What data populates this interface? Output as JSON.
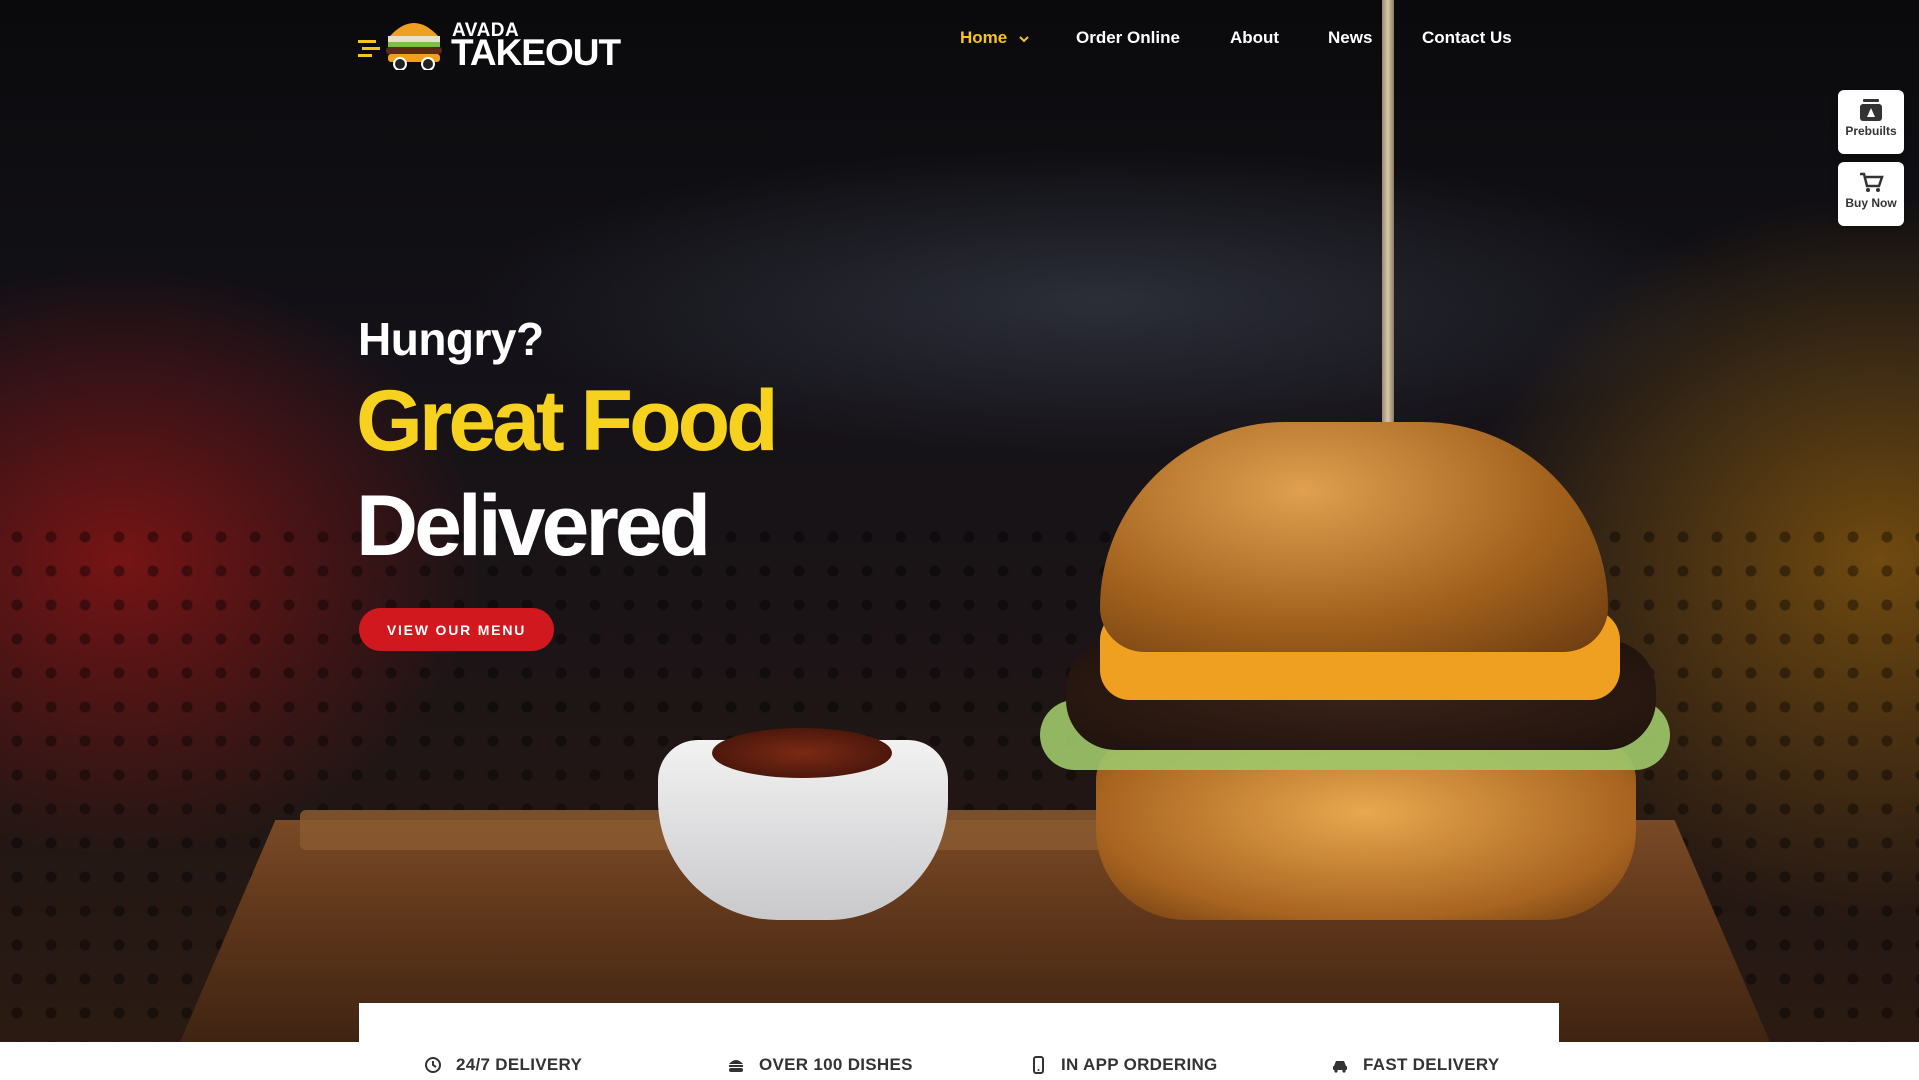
{
  "brand": {
    "small": "AVADA",
    "big": "TAKEOUT",
    "logo_icon": "burger-truck-icon"
  },
  "nav": {
    "items": [
      {
        "label": "Home",
        "active": true,
        "has_dropdown": true
      },
      {
        "label": "Order Online",
        "active": false
      },
      {
        "label": "About",
        "active": false
      },
      {
        "label": "News",
        "active": false
      },
      {
        "label": "Contact Us",
        "active": false
      }
    ],
    "active_color": "#f6c51a"
  },
  "side_buttons": [
    {
      "label": "Prebuilts",
      "icon": "prebuilts-icon"
    },
    {
      "label": "Buy Now",
      "icon": "cart-icon"
    }
  ],
  "hero": {
    "kicker": "Hungry?",
    "headline_1": "Great Food",
    "headline_2": "Delivered",
    "cta_label": "VIEW OUR MENU",
    "cta_color": "#d2181f",
    "accent_color": "#f6d21e"
  },
  "features": [
    {
      "label": "24/7 DELIVERY",
      "icon": "clock-icon"
    },
    {
      "label": "OVER 100 DISHES",
      "icon": "burger-icon"
    },
    {
      "label": "IN APP ORDERING",
      "icon": "mobile-icon"
    },
    {
      "label": "FAST DELIVERY",
      "icon": "car-icon"
    }
  ]
}
